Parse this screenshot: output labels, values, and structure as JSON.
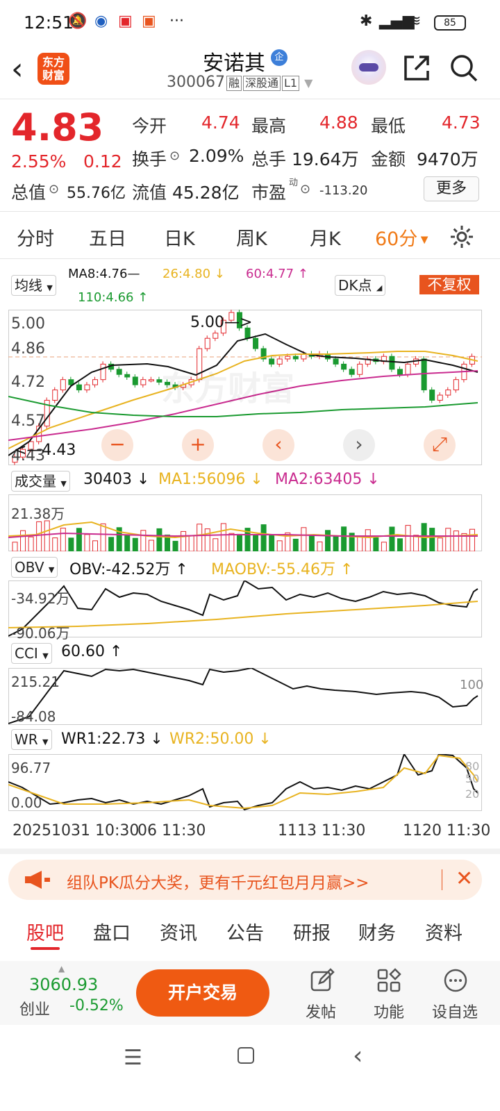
{
  "status": {
    "time": "12:51",
    "battery": "85"
  },
  "header": {
    "logo": [
      "东方",
      "财富"
    ],
    "stock_name": "安诺其",
    "qi_badge": "企",
    "code": "300067",
    "tags": [
      "融",
      "深股通",
      "L1"
    ]
  },
  "quote": {
    "price": "4.83",
    "change_pct": "2.55%",
    "change": "0.12",
    "open_label": "今开",
    "open": "4.74",
    "high_label": "最高",
    "high": "4.88",
    "low_label": "最低",
    "low": "4.73",
    "turnover_label": "换手",
    "turnover": "2.09%",
    "volume_label": "总手",
    "volume": "19.64万",
    "amount_label": "金额",
    "amount": "9470万",
    "mcap_label": "总值",
    "mcap": "55.76亿",
    "float_label": "流值",
    "float_mcap": "45.28亿",
    "pe_label": "市盈",
    "pe_sup": "动",
    "pe": "-113.20",
    "more": "更多"
  },
  "period_tabs": [
    "分时",
    "五日",
    "日K",
    "周K",
    "月K",
    "60分"
  ],
  "chart": {
    "ma_selector": "均线",
    "ma8": "MA8:4.76—",
    "ma26": "26:4.80",
    "ma60": "60:4.77",
    "ma110": "110:4.66",
    "dk": "DK点",
    "fq": "不复权",
    "price_axis": [
      "5.00",
      "4.86",
      "4.72",
      "4.57",
      "4.43"
    ],
    "high_marker": "5.00—>",
    "low_marker": "<—4.43",
    "watermark": "东方财富",
    "zoom_buttons": [
      "−",
      "+",
      "‹",
      "›",
      "⤢"
    ],
    "volume": {
      "selector": "成交量",
      "value": "30403",
      "ma1": "MA1:56096",
      "ma2": "MA2:63405",
      "axis_top": "21.38万"
    },
    "obv": {
      "selector": "OBV",
      "value": "OBV:-42.52万",
      "ma": "MAOBV:-55.46万",
      "axis_top": "-34.92万",
      "axis_bottom": "-90.06万"
    },
    "cci": {
      "selector": "CCI",
      "value": "60.60",
      "axis_top": "215.21",
      "axis_bottom": "-84.08",
      "right_label": "100"
    },
    "wr": {
      "selector": "WR",
      "wr1": "WR1:22.73",
      "wr2": "WR2:50.00",
      "axis_top": "96.77",
      "axis_bottom": "0.00",
      "right_top": "80",
      "right_mid": "50",
      "right_bottom": "20"
    },
    "time_axis": [
      "20251031 10:30",
      "06 11:30",
      "1113 11:30",
      "1120 11:30"
    ]
  },
  "chart_data": {
    "type": "candlestick",
    "price_range": [
      4.43,
      5.0
    ],
    "high": 5.0,
    "low": 4.43,
    "last": 4.83
  },
  "promo": {
    "text": "组队PK瓜分大奖，更有千元红包月月赢>>"
  },
  "bottom_tabs": [
    "股吧",
    "盘口",
    "资讯",
    "公告",
    "研报",
    "财务",
    "资料"
  ],
  "bottom_bar": {
    "index_value": "3060.93",
    "index_name": "创业",
    "index_change": "-0.52%",
    "trade": "开户交易",
    "post": "发帖",
    "func": "功能",
    "watch": "设自选"
  }
}
